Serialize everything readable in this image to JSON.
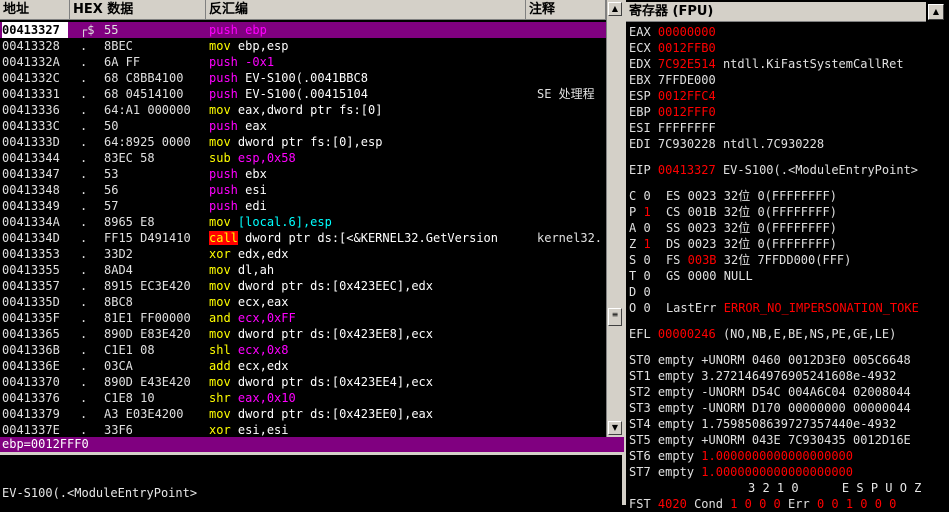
{
  "disasm_header": {
    "address": "地址",
    "hex": "HEX 数据",
    "disassembly": "反汇编",
    "comment": "注释"
  },
  "disasm_rows": [
    {
      "addr": "00413327",
      "mark": "┌$",
      "hex": "55",
      "mn": "push",
      "ops": "ebp",
      "cmt": "",
      "sel": true
    },
    {
      "addr": "00413328",
      "mark": ".",
      "hex": "8BEC",
      "mn": "mov",
      "ops": "ebp,esp",
      "cmt": ""
    },
    {
      "addr": "0041332A",
      "mark": ".",
      "hex": "6A FF",
      "mn": "push",
      "ops": "-0x1",
      "cmt": "",
      "imm": true
    },
    {
      "addr": "0041332C",
      "mark": ".",
      "hex": "68 C8BB4100",
      "mn": "push",
      "ops": "EV-S100(.0041BBC8",
      "cmt": ""
    },
    {
      "addr": "00413331",
      "mark": ".",
      "hex": "68 04514100",
      "mn": "push",
      "ops": "EV-S100(.00415104",
      "cmt": "SE 处理程"
    },
    {
      "addr": "00413336",
      "mark": ".",
      "hex": "64:A1 000000",
      "mn": "mov",
      "ops": "eax,dword ptr fs:[0]",
      "cmt": ""
    },
    {
      "addr": "0041333C",
      "mark": ".",
      "hex": "50",
      "mn": "push",
      "ops": "eax",
      "cmt": ""
    },
    {
      "addr": "0041333D",
      "mark": ".",
      "hex": "64:8925 0000",
      "mn": "mov",
      "ops": "dword ptr fs:[0],esp",
      "cmt": ""
    },
    {
      "addr": "00413344",
      "mark": ".",
      "hex": "83EC 58",
      "mn": "sub",
      "ops": "esp,0x58",
      "cmt": "",
      "imm": true
    },
    {
      "addr": "00413347",
      "mark": ".",
      "hex": "53",
      "mn": "push",
      "ops": "ebx",
      "cmt": ""
    },
    {
      "addr": "00413348",
      "mark": ".",
      "hex": "56",
      "mn": "push",
      "ops": "esi",
      "cmt": ""
    },
    {
      "addr": "00413349",
      "mark": ".",
      "hex": "57",
      "mn": "push",
      "ops": "edi",
      "cmt": ""
    },
    {
      "addr": "0041334A",
      "mark": ".",
      "hex": "8965 E8",
      "mn": "mov",
      "ops": "[local.6],esp",
      "cmt": "",
      "local": true
    },
    {
      "addr": "0041334D",
      "mark": ".",
      "hex": "FF15 D491410",
      "mn": "call",
      "ops": "dword ptr ds:[<&KERNEL32.GetVersion",
      "cmt": "kernel32.",
      "call": true
    },
    {
      "addr": "00413353",
      "mark": ".",
      "hex": "33D2",
      "mn": "xor",
      "ops": "edx,edx",
      "cmt": ""
    },
    {
      "addr": "00413355",
      "mark": ".",
      "hex": "8AD4",
      "mn": "mov",
      "ops": "dl,ah",
      "cmt": ""
    },
    {
      "addr": "00413357",
      "mark": ".",
      "hex": "8915 EC3E420",
      "mn": "mov",
      "ops": "dword ptr ds:[0x423EEC],edx",
      "cmt": ""
    },
    {
      "addr": "0041335D",
      "mark": ".",
      "hex": "8BC8",
      "mn": "mov",
      "ops": "ecx,eax",
      "cmt": ""
    },
    {
      "addr": "0041335F",
      "mark": ".",
      "hex": "81E1 FF00000",
      "mn": "and",
      "ops": "ecx,0xFF",
      "cmt": "",
      "imm": true
    },
    {
      "addr": "00413365",
      "mark": ".",
      "hex": "890D E83E420",
      "mn": "mov",
      "ops": "dword ptr ds:[0x423EE8],ecx",
      "cmt": ""
    },
    {
      "addr": "0041336B",
      "mark": ".",
      "hex": "C1E1 08",
      "mn": "shl",
      "ops": "ecx,0x8",
      "cmt": "",
      "imm": true
    },
    {
      "addr": "0041336E",
      "mark": ".",
      "hex": "03CA",
      "mn": "add",
      "ops": "ecx,edx",
      "cmt": ""
    },
    {
      "addr": "00413370",
      "mark": ".",
      "hex": "890D E43E420",
      "mn": "mov",
      "ops": "dword ptr ds:[0x423EE4],ecx",
      "cmt": ""
    },
    {
      "addr": "00413376",
      "mark": ".",
      "hex": "C1E8 10",
      "mn": "shr",
      "ops": "eax,0x10",
      "cmt": "",
      "imm": true
    },
    {
      "addr": "00413379",
      "mark": ".",
      "hex": "A3 E03E4200",
      "mn": "mov",
      "ops": "dword ptr ds:[0x423EE0],eax",
      "cmt": ""
    },
    {
      "addr": "0041337E",
      "mark": ".",
      "hex": "33F6",
      "mn": "xor",
      "ops": "esi,esi",
      "cmt": ""
    }
  ],
  "info_pane": {
    "line1": "ebp=0012FFF0",
    "status": "EV-S100(.<ModuleEntryPoint>"
  },
  "registers": {
    "title": "寄存器 (FPU)",
    "gp": [
      {
        "name": "EAX",
        "value": "00000000",
        "red": true,
        "extra": ""
      },
      {
        "name": "ECX",
        "value": "0012FFB0",
        "red": true,
        "extra": ""
      },
      {
        "name": "EDX",
        "value": "7C92E514",
        "red": true,
        "extra": "ntdll.KiFastSystemCallRet"
      },
      {
        "name": "EBX",
        "value": "7FFDE000",
        "red": false,
        "extra": ""
      },
      {
        "name": "ESP",
        "value": "0012FFC4",
        "red": true,
        "extra": ""
      },
      {
        "name": "EBP",
        "value": "0012FFF0",
        "red": true,
        "extra": ""
      },
      {
        "name": "ESI",
        "value": "FFFFFFFF",
        "red": false,
        "extra": ""
      },
      {
        "name": "EDI",
        "value": "7C930228",
        "red": false,
        "extra": "ntdll.7C930228"
      }
    ],
    "eip": {
      "name": "EIP",
      "value": "00413327",
      "extra": "EV-S100(.<ModuleEntryPoint>"
    },
    "flags": [
      {
        "f": "C",
        "v": "0",
        "seg": "ES",
        "sel": "0023",
        "bits": "32位",
        "base": "0(FFFFFFFF)",
        "red": false
      },
      {
        "f": "P",
        "v": "1",
        "seg": "CS",
        "sel": "001B",
        "bits": "32位",
        "base": "0(FFFFFFFF)",
        "red": true
      },
      {
        "f": "A",
        "v": "0",
        "seg": "SS",
        "sel": "0023",
        "bits": "32位",
        "base": "0(FFFFFFFF)",
        "red": false
      },
      {
        "f": "Z",
        "v": "1",
        "seg": "DS",
        "sel": "0023",
        "bits": "32位",
        "base": "0(FFFFFFFF)",
        "red": true
      },
      {
        "f": "S",
        "v": "0",
        "seg": "FS",
        "sel": "003B",
        "bits": "32位",
        "base": "7FFDD000(FFF)",
        "red": false,
        "selred": true
      },
      {
        "f": "T",
        "v": "0",
        "seg": "GS",
        "sel": "0000",
        "bits": "NULL",
        "base": "",
        "red": false
      },
      {
        "f": "D",
        "v": "0",
        "seg": "",
        "sel": "",
        "bits": "",
        "base": "",
        "red": false
      }
    ],
    "lasterr": {
      "f": "O",
      "v": "0",
      "label": "LastErr",
      "value": "ERROR_NO_IMPERSONATION_TOKE"
    },
    "efl": {
      "name": "EFL",
      "value": "00000246",
      "extra": "(NO,NB,E,BE,NS,PE,GE,LE)"
    },
    "fpu": [
      {
        "name": "ST0",
        "text": "empty +UNORM 0460 0012D3E0 005C6648",
        "red": false
      },
      {
        "name": "ST1",
        "text": "empty 3.2721464976905241608e-4932",
        "red": false
      },
      {
        "name": "ST2",
        "text": "empty -UNORM D54C 004A6C04 02008044",
        "red": false
      },
      {
        "name": "ST3",
        "text": "empty -UNORM D170 00000000 00000044",
        "red": false
      },
      {
        "name": "ST4",
        "text": "empty 1.7598508639727357440e-4932",
        "red": false
      },
      {
        "name": "ST5",
        "text": "empty +UNORM 043E 7C930435 0012D16E",
        "red": false
      },
      {
        "name": "ST6",
        "text": "empty",
        "value": "1.0000000000000000000",
        "red": true
      },
      {
        "name": "ST7",
        "text": "empty",
        "value": "1.0000000000000000000",
        "red": true
      }
    ],
    "fst_header": "3 2 1 0      E S P U O Z",
    "fst": {
      "name": "FST",
      "value": "4020",
      "cond_label": "Cond",
      "cond": "1 0 0 0",
      "err_label": "Err",
      "err": "0 0 1 0 0 0"
    }
  }
}
